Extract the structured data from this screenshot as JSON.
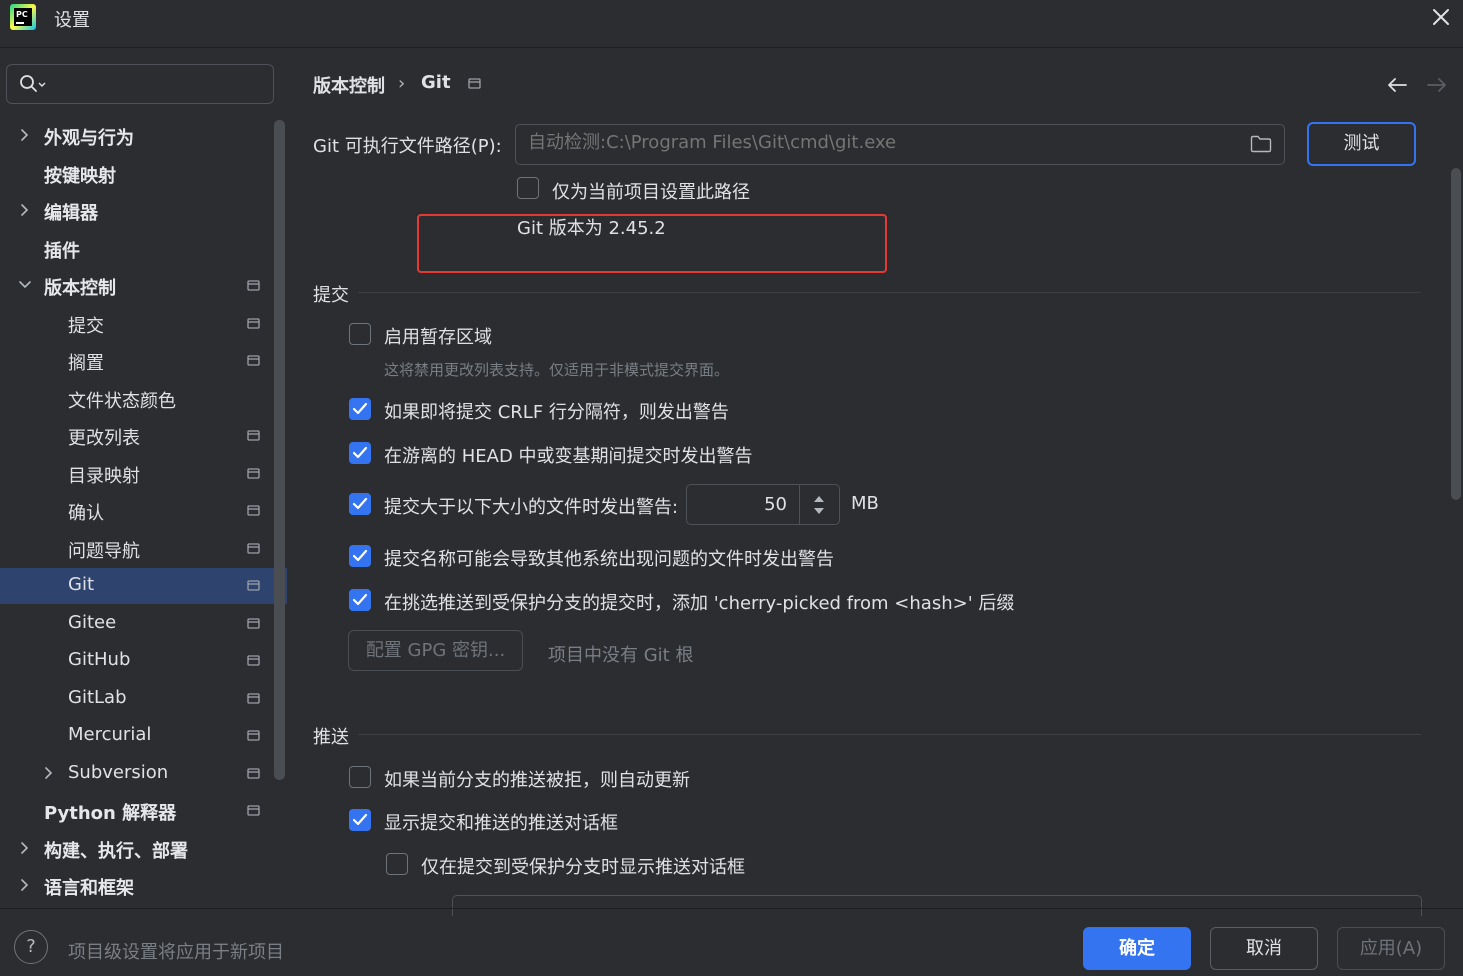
{
  "window": {
    "title": "设置",
    "logo_text": "PC"
  },
  "sidebar": {
    "search_placeholder": "",
    "items": [
      {
        "label": "外观与行为",
        "bold": true,
        "chevron": "right",
        "indent": 0,
        "project_icon": false
      },
      {
        "label": "按键映射",
        "bold": true,
        "chevron": "none",
        "indent": 0,
        "project_icon": false
      },
      {
        "label": "编辑器",
        "bold": true,
        "chevron": "right",
        "indent": 0,
        "project_icon": false
      },
      {
        "label": "插件",
        "bold": true,
        "chevron": "none",
        "indent": 0,
        "project_icon": false
      },
      {
        "label": "版本控制",
        "bold": true,
        "chevron": "down",
        "indent": 0,
        "project_icon": true
      },
      {
        "label": "提交",
        "bold": false,
        "chevron": "none",
        "indent": 1,
        "project_icon": true
      },
      {
        "label": "搁置",
        "bold": false,
        "chevron": "none",
        "indent": 1,
        "project_icon": true
      },
      {
        "label": "文件状态颜色",
        "bold": false,
        "chevron": "none",
        "indent": 1,
        "project_icon": false
      },
      {
        "label": "更改列表",
        "bold": false,
        "chevron": "none",
        "indent": 1,
        "project_icon": true
      },
      {
        "label": "目录映射",
        "bold": false,
        "chevron": "none",
        "indent": 1,
        "project_icon": true
      },
      {
        "label": "确认",
        "bold": false,
        "chevron": "none",
        "indent": 1,
        "project_icon": true
      },
      {
        "label": "问题导航",
        "bold": false,
        "chevron": "none",
        "indent": 1,
        "project_icon": true
      },
      {
        "label": "Git",
        "bold": false,
        "chevron": "none",
        "indent": 1,
        "project_icon": true,
        "selected": true
      },
      {
        "label": "Gitee",
        "bold": false,
        "chevron": "none",
        "indent": 1,
        "project_icon": true
      },
      {
        "label": "GitHub",
        "bold": false,
        "chevron": "none",
        "indent": 1,
        "project_icon": true
      },
      {
        "label": "GitLab",
        "bold": false,
        "chevron": "none",
        "indent": 1,
        "project_icon": true
      },
      {
        "label": "Mercurial",
        "bold": false,
        "chevron": "none",
        "indent": 1,
        "project_icon": true
      },
      {
        "label": "Subversion",
        "bold": false,
        "chevron": "right",
        "indent": 1,
        "project_icon": true
      },
      {
        "label": "Python 解释器",
        "bold": true,
        "chevron": "none",
        "indent": 0,
        "project_icon": true
      },
      {
        "label": "构建、执行、部署",
        "bold": true,
        "chevron": "right",
        "indent": 0,
        "project_icon": false
      },
      {
        "label": "语言和框架",
        "bold": true,
        "chevron": "right",
        "indent": 0,
        "project_icon": false
      }
    ]
  },
  "breadcrumb": {
    "parent": "版本控制",
    "separator": "›",
    "current": "Git"
  },
  "git_path": {
    "label": "Git 可执行文件路径(P):",
    "placeholder": "自动检测:C:\\Program Files\\Git\\cmd\\git.exe",
    "test_button": "测试",
    "project_only_label": "仅为当前项目设置此路径",
    "project_only_checked": false,
    "version_text": "Git 版本为 2.45.2"
  },
  "commit": {
    "title": "提交",
    "staging_label": "启用暂存区域",
    "staging_checked": false,
    "staging_hint": "这将禁用更改列表支持。仅适用于非模式提交界面。",
    "crlf_label": "如果即将提交 CRLF 行分隔符，则发出警告",
    "crlf_checked": true,
    "detached_label": "在游离的 HEAD 中或变基期间提交时发出警告",
    "detached_checked": true,
    "size_label": "提交大于以下大小的文件时发出警告:",
    "size_checked": true,
    "size_value": "50",
    "size_unit": "MB",
    "names_label": "提交名称可能会导致其他系统出现问题的文件时发出警告",
    "names_checked": true,
    "cherry_label": "在挑选推送到受保护分支的提交时，添加 'cherry-picked from <hash>' 后缀",
    "cherry_checked": true,
    "gpg_button": "配置 GPG 密钥...",
    "no_git_root": "项目中没有 Git 根"
  },
  "push": {
    "title": "推送",
    "auto_update_label": "如果当前分支的推送被拒，则自动更新",
    "auto_update_checked": false,
    "show_dialog_label": "显示提交和推送的推送对话框",
    "show_dialog_checked": true,
    "protected_only_label": "仅在提交到受保护分支时显示推送对话框",
    "protected_only_checked": false
  },
  "footer": {
    "help": "?",
    "hint": "项目级设置将应用于新项目",
    "ok": "确定",
    "cancel": "取消",
    "apply": "应用(A)"
  },
  "colors": {
    "background": "#2b2d30",
    "accent": "#3574f0",
    "selection": "#2e436e",
    "highlight_box": "#e53935"
  }
}
